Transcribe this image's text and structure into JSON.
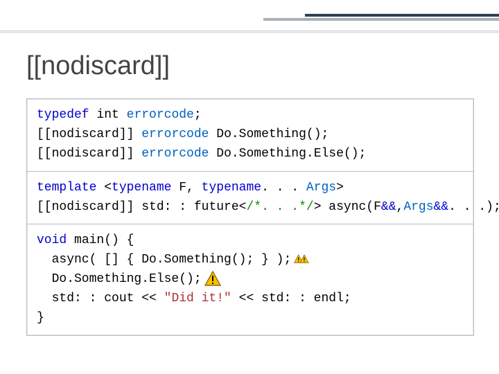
{
  "title": "[[nodiscard]]",
  "code": {
    "b1": {
      "l1a": "typedef",
      "l1b": " int ",
      "l1c": "errorcode",
      "l1d": ";",
      "l2a": "[[nodiscard]] ",
      "l2b": "errorcode ",
      "l2c": "Do.Something();",
      "l3a": "[[nodiscard]] ",
      "l3b": "errorcode ",
      "l3c": "Do.Something.Else();"
    },
    "b2": {
      "l1a": "template",
      "l1b": " <",
      "l1c": "typename",
      "l1d": " F, ",
      "l1e": "typename",
      "l1f": ". . . ",
      "l1g": "Args",
      "l1h": ">",
      "l2a": "[[nodiscard]] ",
      "l2b": "std: : future<",
      "l2c": "/*. . .*/",
      "l2d": "> async(F",
      "l2e": "&&",
      "l2f": ",",
      "l2g": "Args",
      "l2h": "&&",
      "l2i": ". . .);"
    },
    "b3": {
      "l1a": "void",
      "l1b": " main() {",
      "l2": "  async( [] { Do.Something(); } );",
      "l3": "  Do.Something.Else();",
      "l4a": "  std: : cout << ",
      "l4b": "\"Did it!\"",
      "l4c": " << std: : endl;",
      "l5": "}"
    }
  }
}
